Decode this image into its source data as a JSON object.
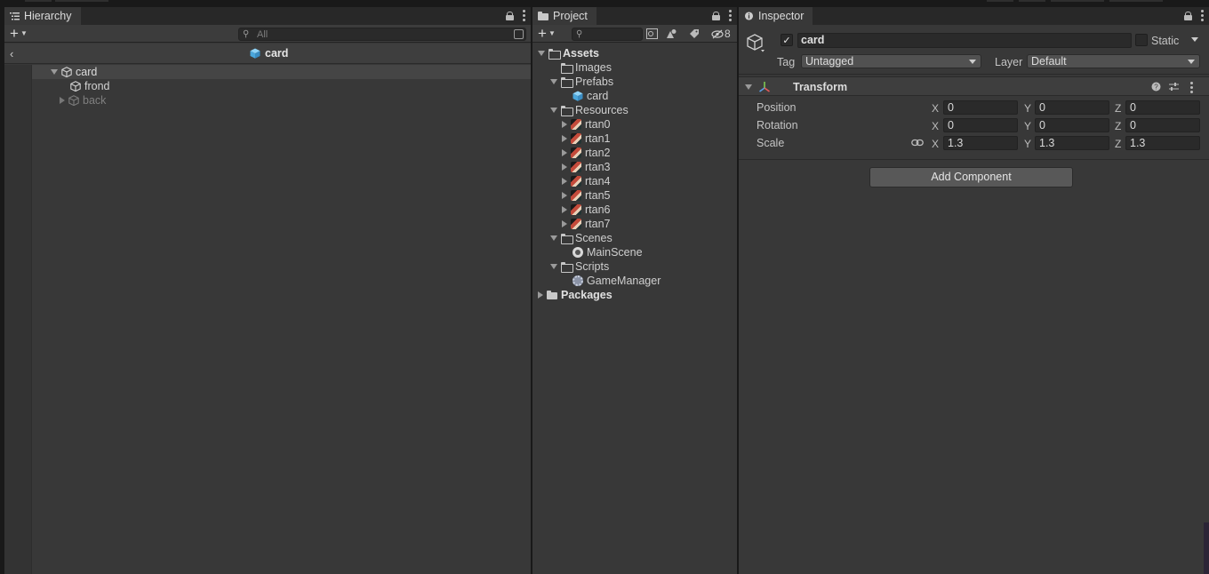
{
  "hierarchy": {
    "tab_label": "Hierarchy",
    "search_placeholder": "All",
    "breadcrumb_title": "card",
    "items": [
      {
        "label": "card"
      },
      {
        "label": "frond"
      },
      {
        "label": "back"
      }
    ]
  },
  "project": {
    "tab_label": "Project",
    "hidden_count": "8",
    "tree": [
      {
        "label": "Assets"
      },
      {
        "label": "Images"
      },
      {
        "label": "Prefabs"
      },
      {
        "label": "card"
      },
      {
        "label": "Resources"
      },
      {
        "label": "rtan0"
      },
      {
        "label": "rtan1"
      },
      {
        "label": "rtan2"
      },
      {
        "label": "rtan3"
      },
      {
        "label": "rtan4"
      },
      {
        "label": "rtan5"
      },
      {
        "label": "rtan6"
      },
      {
        "label": "rtan7"
      },
      {
        "label": "Scenes"
      },
      {
        "label": "MainScene"
      },
      {
        "label": "Scripts"
      },
      {
        "label": "GameManager"
      },
      {
        "label": "Packages"
      }
    ]
  },
  "inspector": {
    "tab_label": "Inspector",
    "object_name": "card",
    "static_label": "Static",
    "tag_label": "Tag",
    "tag_value": "Untagged",
    "layer_label": "Layer",
    "layer_value": "Default",
    "transform": {
      "title": "Transform",
      "position_label": "Position",
      "rotation_label": "Rotation",
      "scale_label": "Scale",
      "axis_x": "X",
      "axis_y": "Y",
      "axis_z": "Z",
      "position": {
        "x": "0",
        "y": "0",
        "z": "0"
      },
      "rotation": {
        "x": "0",
        "y": "0",
        "z": "0"
      },
      "scale": {
        "x": "1.3",
        "y": "1.3",
        "z": "1.3"
      }
    },
    "add_component_label": "Add Component"
  },
  "colors": {
    "accent_cube": "#5fb6e8",
    "panel_bg": "#383838",
    "tab_bar_bg": "#282828",
    "selected_row": "#454545"
  }
}
